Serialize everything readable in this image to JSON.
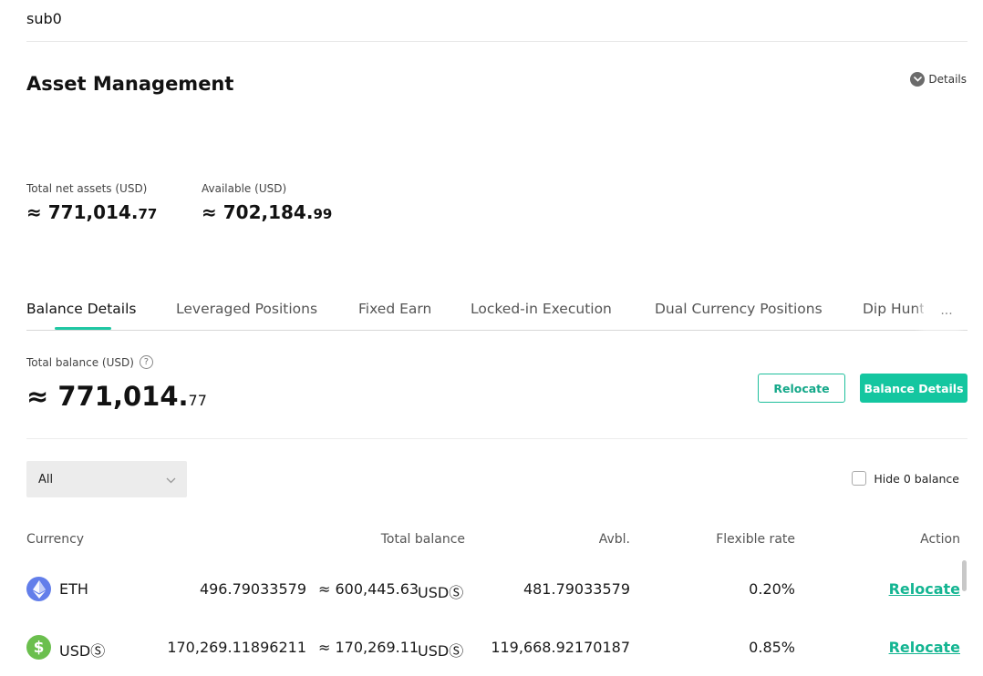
{
  "account": {
    "name": "sub0"
  },
  "header": {
    "title": "Asset Management",
    "details_label": "Details"
  },
  "summary": {
    "total_net": {
      "label": "Total net assets (USD)",
      "prefix": "≈ ",
      "integer": "771,014.",
      "decimal": "77"
    },
    "available": {
      "label": "Available (USD)",
      "prefix": "≈ ",
      "integer": "702,184.",
      "decimal": "99"
    }
  },
  "tabs": {
    "items": [
      {
        "label": "Balance Details"
      },
      {
        "label": "Leveraged Positions"
      },
      {
        "label": "Fixed Earn"
      },
      {
        "label": "Locked-in Execution"
      },
      {
        "label": "Dual Currency Positions"
      },
      {
        "label": "Dip Hunter"
      }
    ],
    "more_label": "···"
  },
  "balance": {
    "label": "Total balance (USD)",
    "help_glyph": "?",
    "prefix": "≈ ",
    "integer": "771,014.",
    "decimal": "77",
    "relocate_label": "Relocate",
    "details_label": "Balance Details"
  },
  "filter": {
    "selected": "All",
    "hide_zero_label": "Hide 0 balance"
  },
  "table": {
    "headers": {
      "currency": "Currency",
      "total": "Total balance",
      "avbl": "Avbl.",
      "rate": "Flexible rate",
      "action": "Action"
    },
    "rows": [
      {
        "icon": "eth-icon",
        "name": "ETH",
        "total": "496.79033579",
        "approx": "≈ 600,445.63",
        "unit": "USDⓈ",
        "avbl": "481.79033579",
        "rate": "0.20%",
        "action": "Relocate"
      },
      {
        "icon": "usds-icon",
        "icon_glyph": "$",
        "name": "USDⓈ",
        "total": "170,269.11896211",
        "approx": "≈ 170,269.11",
        "unit": "USDⓈ",
        "avbl": "119,668.92170187",
        "rate": "0.85%",
        "action": "Relocate"
      }
    ]
  },
  "colors": {
    "accent": "#14c6a0",
    "eth": "#627eea",
    "usds": "#6bbf4e"
  }
}
